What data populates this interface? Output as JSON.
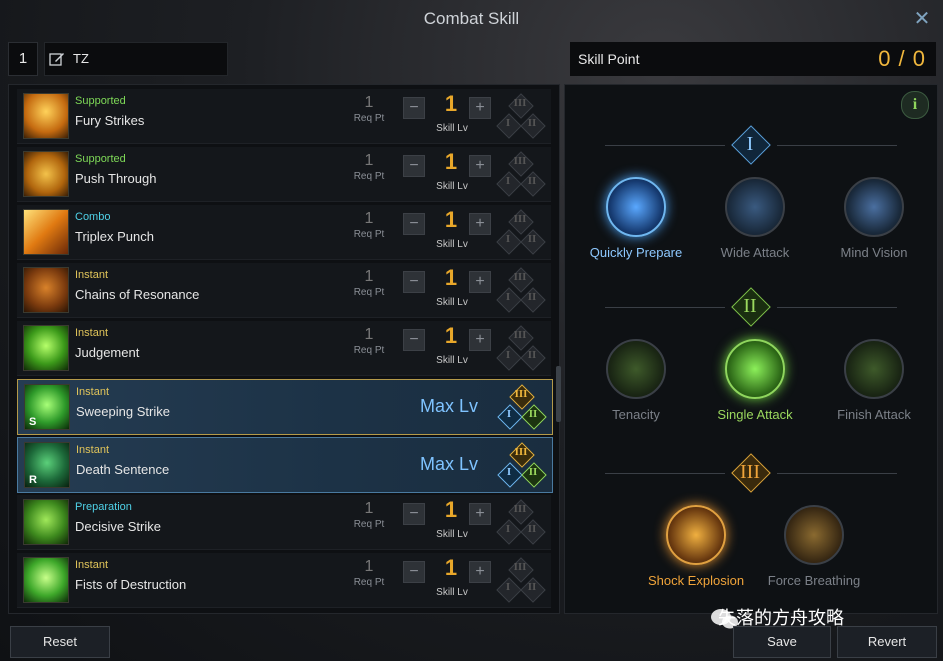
{
  "window": {
    "title": "Combat Skill"
  },
  "preset": {
    "number": "1",
    "name": "TZ"
  },
  "skill_point": {
    "label": "Skill Point",
    "value": "0 / 0"
  },
  "common": {
    "req_label": "Req Pt",
    "lv_label": "Skill Lv",
    "max_label": "Max Lv",
    "minus": "−",
    "plus": "+",
    "tier1": "I",
    "tier2": "II",
    "tier3": "III"
  },
  "skills": [
    {
      "type": "Supported",
      "name": "Fury Strikes",
      "req": "1",
      "level": "1"
    },
    {
      "type": "Supported",
      "name": "Push Through",
      "req": "1",
      "level": "1"
    },
    {
      "type": "Combo",
      "name": "Triplex Punch",
      "req": "1",
      "level": "1"
    },
    {
      "type": "Instant",
      "name": "Chains of Resonance",
      "req": "1",
      "level": "1"
    },
    {
      "type": "Instant",
      "name": "Judgement",
      "req": "1",
      "level": "1"
    },
    {
      "type": "Instant",
      "name": "Sweeping Strike",
      "key": "S",
      "max": true
    },
    {
      "type": "Instant",
      "name": "Death Sentence",
      "key": "R",
      "max": true
    },
    {
      "type": "Preparation",
      "name": "Decisive Strike",
      "req": "1",
      "level": "1"
    },
    {
      "type": "Instant",
      "name": "Fists of Destruction",
      "req": "1",
      "level": "1"
    }
  ],
  "tripods": {
    "info": "i",
    "tier1": {
      "label": "I",
      "options": [
        "Quickly Prepare",
        "Wide Attack",
        "Mind Vision"
      ]
    },
    "tier2": {
      "label": "II",
      "options": [
        "Tenacity",
        "Single Attack",
        "Finish Attack"
      ]
    },
    "tier3": {
      "label": "III",
      "options": [
        "Shock Explosion",
        "Force Breathing"
      ]
    }
  },
  "buttons": {
    "reset": "Reset",
    "save": "Save",
    "revert": "Revert"
  },
  "watermark": "失落的方舟攻略",
  "colors": {
    "supported": "#7ed957",
    "combo": "#4fd2e8",
    "instant": "#e0c45a",
    "preparation": "#4fd2e8",
    "gold": "#f0b73d",
    "selected_tier1": "#8ec9ff",
    "selected_tier2": "#9bd85e",
    "selected_tier3": "#f0a43a",
    "dim": "#7b8088"
  }
}
